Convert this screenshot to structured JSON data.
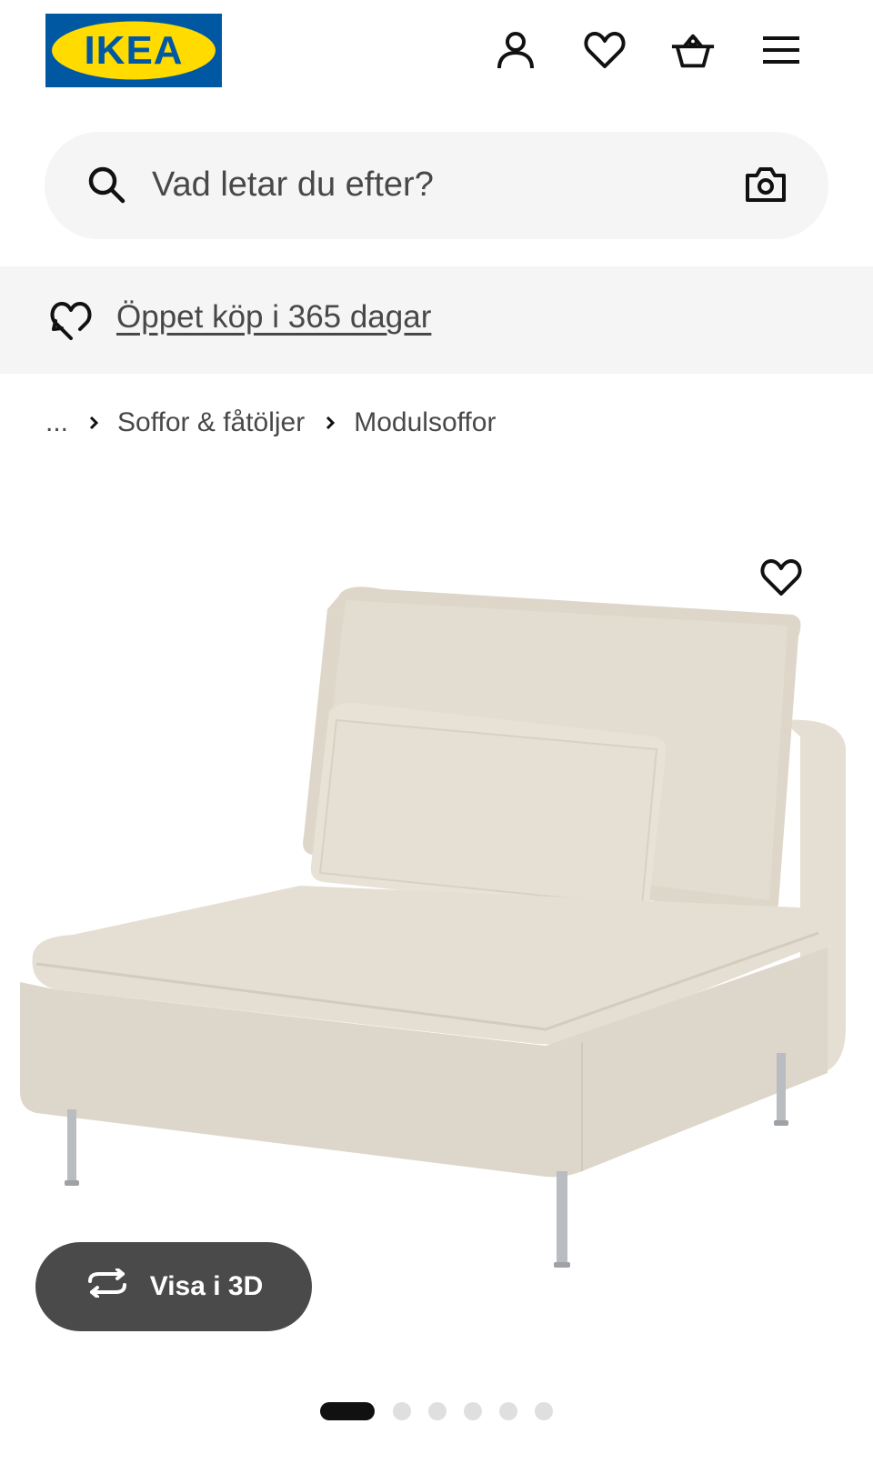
{
  "header": {
    "logo_text": "IKEA",
    "icons": [
      "account-icon",
      "heart-icon",
      "basket-icon",
      "menu-icon"
    ]
  },
  "search": {
    "placeholder": "Vad letar du efter?",
    "icons": [
      "search-icon",
      "camera-icon"
    ]
  },
  "promo": {
    "text": "Öppet köp i 365 dagar",
    "icon": "heart-return-icon"
  },
  "breadcrumb": {
    "items": [
      "...",
      "Soffor & fåtöljer",
      "Modulsoffor"
    ]
  },
  "product": {
    "image": "modular-armchair-section-beige",
    "view3d_label": "Visa i 3D",
    "gallery": {
      "total": 6,
      "active": 1
    }
  },
  "colors": {
    "ikea_blue": "#0058A3",
    "ikea_yellow": "#FFDB00",
    "fabric": "#e2dbcf",
    "button_dark": "#4a4a4a"
  }
}
